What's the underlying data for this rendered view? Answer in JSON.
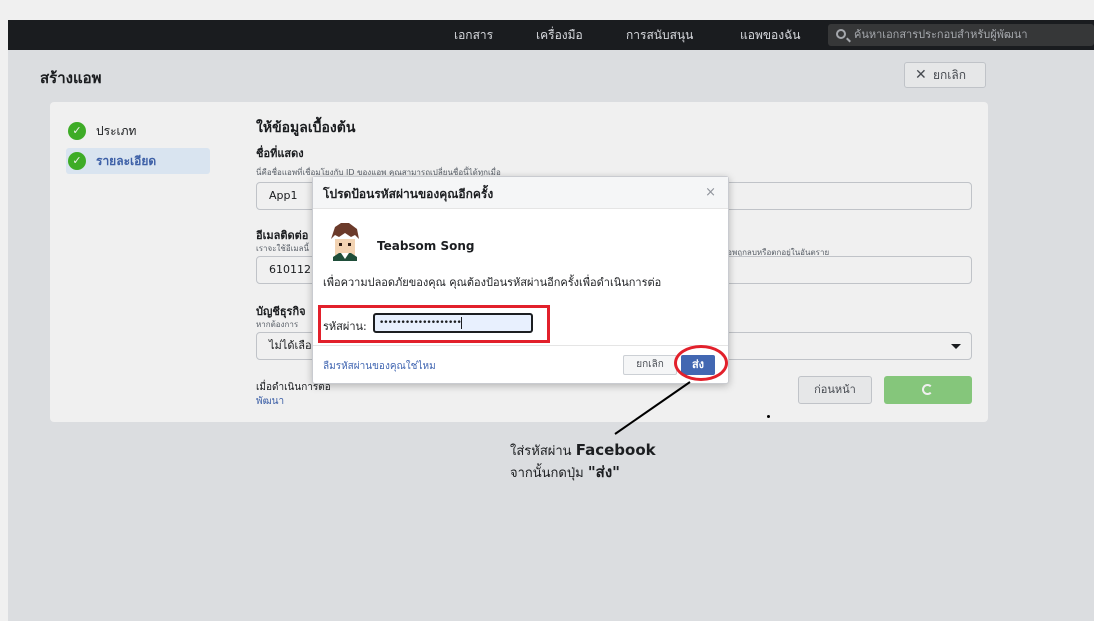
{
  "nav": {
    "items": [
      "เอกสาร",
      "เครื่องมือ",
      "การสนับสนุน",
      "แอพของฉัน"
    ],
    "search_placeholder": "ค้นหาเอกสารประกอบสำหรับผู้พัฒนา"
  },
  "page": {
    "title": "สร้างแอพ",
    "cancel_label": "ยกเลิก"
  },
  "steps": [
    {
      "label": "ประเภท",
      "state": "done"
    },
    {
      "label": "รายละเอียด",
      "state": "active"
    }
  ],
  "form": {
    "section_title": "ให้ข้อมูลเบื้องต้น",
    "display_name": {
      "label": "ชื่อที่แสดง",
      "help": "นี่คือชื่อแอพที่เชื่อมโยงกับ ID ของแอพ คุณสามารถเปลี่ยนชื่อนี้ได้ทุกเมื่อ",
      "value": "App1"
    },
    "email": {
      "label": "อีเมลติดต่อ",
      "help": "เราจะใช้อีเมลนี้",
      "help_right": "แอพถูกลบหรือตกอยู่ในอันตราย",
      "value": "610112"
    },
    "business": {
      "label": "บัญชีธุรกิจ",
      "help": "หากต้องการ",
      "value": "ไม่ได้เลือก"
    },
    "footer_text": "เมื่อดำเนินการต่อ",
    "footer_link": "พัฒนา",
    "prev_label": "ก่อนหน้า"
  },
  "dialog": {
    "title": "โปรดป้อนรหัสผ่านของคุณอีกครั้ง",
    "close": "×",
    "user_name": "Teabsom Song",
    "message": "เพื่อความปลอดภัยของคุณ คุณต้องป้อนรหัสผ่านอีกครั้งเพื่อดำเนินการต่อ",
    "password_label": "รหัสผ่าน:",
    "password_mask": "•••••••••••••••••••",
    "forgot_link": "ลืมรหัสผ่านของคุณใช่ไหม",
    "cancel_label": "ยกเลิก",
    "submit_label": "ส่ง"
  },
  "annotation": {
    "line1_prefix": "ใส่รหัสผ่าน ",
    "line1_bold": "Facebook",
    "line2_prefix": "จากนั้นกดปุ่ม ",
    "line2_bold": "\"ส่ง\""
  },
  "colors": {
    "topbar": "#1c1e21",
    "accent": "#4267b2",
    "success": "#42b72a",
    "highlight": "#e2202b"
  }
}
